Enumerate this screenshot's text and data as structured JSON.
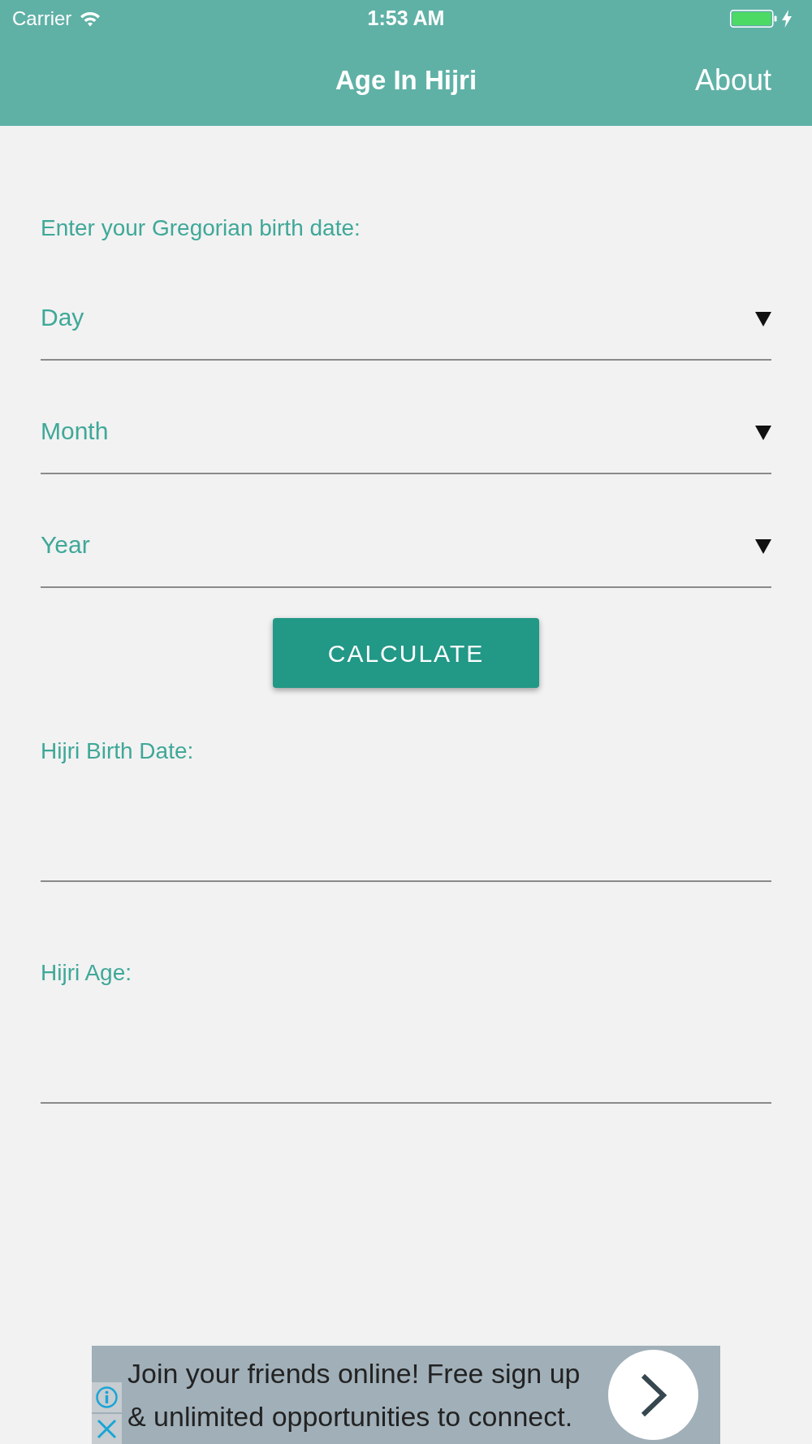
{
  "status_bar": {
    "carrier": "Carrier",
    "time": "1:53 AM"
  },
  "nav_bar": {
    "title": "Age In Hijri",
    "about_button": "About"
  },
  "form": {
    "prompt": "Enter your Gregorian birth date:",
    "dropdowns": [
      {
        "placeholder": "Day"
      },
      {
        "placeholder": "Month"
      },
      {
        "placeholder": "Year"
      }
    ],
    "calculate_button": "CALCULATE"
  },
  "results": [
    {
      "label": "Hijri Birth Date:"
    },
    {
      "label": "Hijri Age:"
    }
  ],
  "ad_banner": {
    "text": "Join your friends online! Free sign up & unlimited opportunities to connect."
  }
}
